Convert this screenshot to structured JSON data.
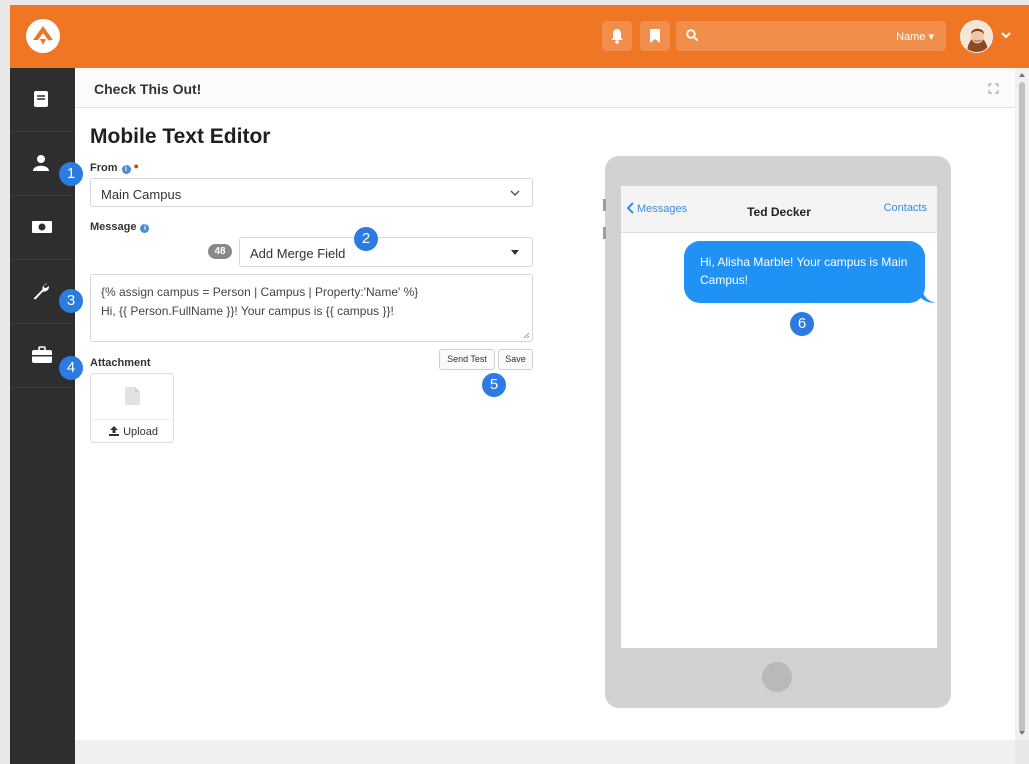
{
  "header": {
    "search_scope": "Name"
  },
  "panel": {
    "title": "Check This Out!"
  },
  "editor": {
    "title": "Mobile Text Editor",
    "from_label": "From",
    "from_value": "Main Campus",
    "message_label": "Message",
    "char_count": "48",
    "merge_field_label": "Add Merge Field",
    "message_lines": [
      "{% assign campus = Person | Campus | Property:'Name' %}",
      "Hi, {{ Person.FullName }}! Your campus is {{ campus }}!"
    ],
    "attachment_label": "Attachment",
    "upload_label": "Upload",
    "send_test_label": "Send Test",
    "save_label": "Save"
  },
  "preview": {
    "back_label": "Messages",
    "contact_name": "Ted Decker",
    "contacts_label": "Contacts",
    "bubble_text": "Hi, Alisha Marble! Your campus is Main Campus!"
  },
  "callouts": [
    "1",
    "2",
    "3",
    "4",
    "5",
    "6"
  ],
  "colors": {
    "header": "#ee7625",
    "sidebar": "#2e2e2e",
    "accent": "#2c7be0",
    "bubble": "#2192f5"
  },
  "icons": {
    "logo": "rock-logo-icon",
    "notifications": "bell-icon",
    "bookmarks": "bookmark-icon",
    "search": "search-icon",
    "sidebar": [
      "book-icon",
      "person-icon",
      "money-icon",
      "wrench-icon",
      "briefcase-icon"
    ]
  }
}
